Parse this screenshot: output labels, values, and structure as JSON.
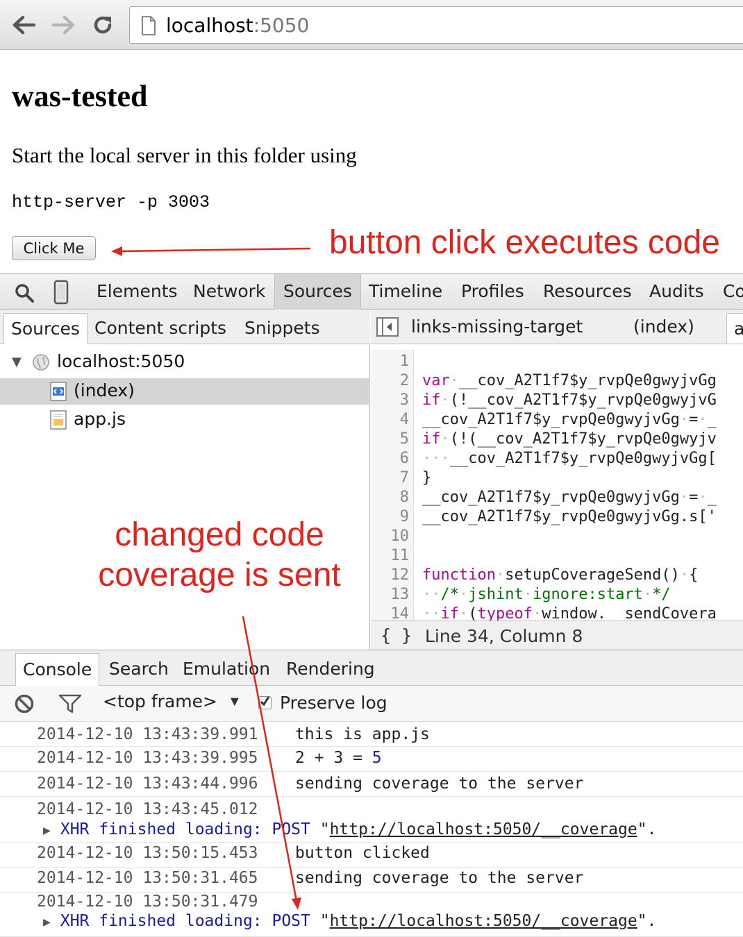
{
  "browser": {
    "url_host": "localhost",
    "url_port": ":5050"
  },
  "page": {
    "title": "was-tested",
    "paragraph": "Start the local server in this folder using",
    "code": "http-server -p 3003",
    "button_label": "Click Me"
  },
  "annotations": {
    "top": "button click executes code",
    "middle": "changed code coverage is sent",
    "color": "#e0231b"
  },
  "devtools": {
    "tabs": [
      "Elements",
      "Network",
      "Sources",
      "Timeline",
      "Profiles",
      "Resources",
      "Audits",
      "Co"
    ],
    "active_tab": "Sources",
    "navigator_tabs": [
      "Sources",
      "Content scripts",
      "Snippets"
    ],
    "tree": {
      "host": "localhost:5050",
      "files": [
        "(index)",
        "app.js"
      ],
      "selected": "(index)"
    },
    "editor_tabs": [
      "links-missing-target",
      "(index)",
      "a"
    ],
    "line_numbers": [
      "1",
      "2",
      "3",
      "4",
      "5",
      "6",
      "7",
      "8",
      "9",
      "10",
      "11",
      "12",
      "13",
      "14"
    ],
    "code_lines": {
      "l2": "__cov_A2T1f7$y_rvpQe0gwyjvGg",
      "l3": "(!__cov_A2T1f7$y_rvpQe0gwyjvG",
      "l4": "__cov_A2T1f7$y_rvpQe0gwyjvGg",
      "l5": "(!(__cov_A2T1f7$y_rvpQe0gwyjv",
      "l6": "__cov_A2T1f7$y_rvpQe0gwyjvGg[",
      "l7": "}",
      "l8": "__cov_A2T1f7$y_rvpQe0gwyjvGg",
      "l9": "__cov_A2T1f7$y_rvpQe0gwyjvGg.s['",
      "l12": "setupCoverageSend()",
      "l13": "jshint",
      "l13b": "ignore:start",
      "l14": "window.__sendCovera"
    },
    "status_braces": "{ }",
    "cursor_position": "Line 34, Column 8"
  },
  "drawer": {
    "tabs": [
      "Console",
      "Search",
      "Emulation",
      "Rendering"
    ],
    "active_tab": "Console",
    "frame_selector": "<top frame>",
    "preserve_log_label": "Preserve log",
    "preserve_log_checked": true
  },
  "console": {
    "messages": [
      {
        "time": "2014-12-10 13:43:39.991",
        "text": "this is app.js"
      },
      {
        "time": "2014-12-10 13:43:39.995",
        "text_pre": "2 + 3 = ",
        "value": "5"
      },
      {
        "time": "2014-12-10 13:43:44.996",
        "text": "sending coverage to the server"
      },
      {
        "time": "2014-12-10 13:43:45.012",
        "xhr_label": "XHR finished loading: POST ",
        "xhr_url": "http://localhost:5050/__coverage",
        "xhr_end": "\"."
      },
      {
        "time": "2014-12-10 13:50:15.453",
        "text": "button clicked"
      },
      {
        "time": "2014-12-10 13:50:31.465",
        "text": "sending coverage to the server"
      },
      {
        "time": "2014-12-10 13:50:31.479",
        "xhr_label": "XHR finished loading: POST ",
        "xhr_url": "http://localhost:5050/__coverage",
        "xhr_end": "\"."
      }
    ]
  }
}
